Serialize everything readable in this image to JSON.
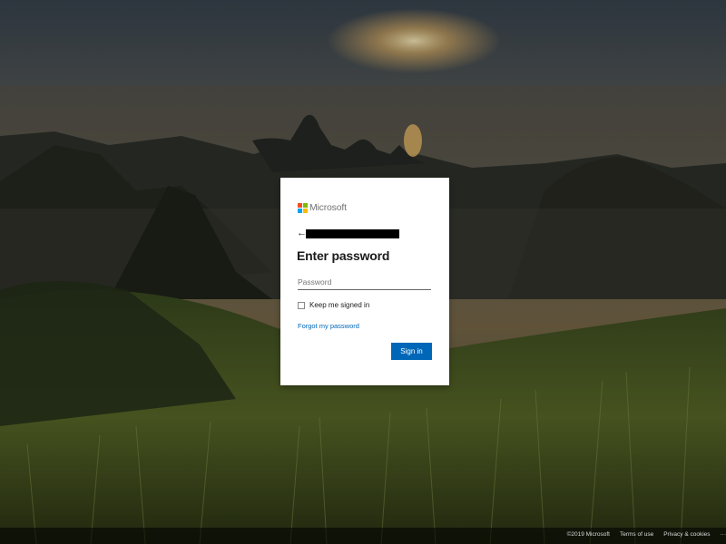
{
  "background": {
    "description_icon": "landscape-background"
  },
  "brand": {
    "name": "Microsoft",
    "logo_colors": [
      "#f25022",
      "#7fba00",
      "#00a4ef",
      "#ffb900"
    ]
  },
  "signin": {
    "back_icon": "back-arrow-icon",
    "back_glyph": "←",
    "identity_redacted": true,
    "title": "Enter password",
    "password_placeholder": "Password",
    "password_value": "",
    "keep_signed_in_label": "Keep me signed in",
    "keep_signed_in_checked": false,
    "forgot_link": "Forgot my password",
    "signin_button": "Sign in",
    "accent_color": "#0067b8"
  },
  "footer": {
    "copyright": "©2019 Microsoft",
    "terms": "Terms of use",
    "privacy": "Privacy & cookies",
    "more": "···"
  }
}
